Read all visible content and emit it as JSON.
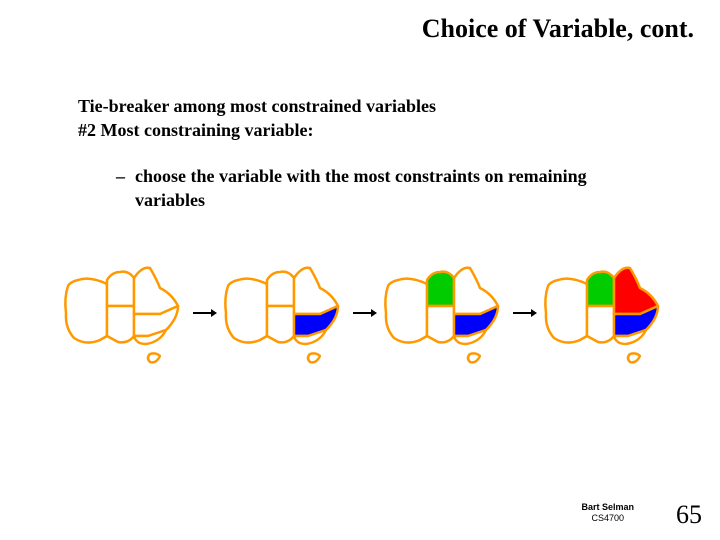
{
  "title": "Choice of Variable, cont.",
  "line1": "Tie-breaker among most constrained variables",
  "line2": "#2 Most constraining variable:",
  "bullet_dash": "–",
  "bullet_text": "choose the variable with the most constraints on remaining variables",
  "maps": [
    {
      "sa": "#ffffff",
      "nsw": "#ffffff",
      "nt": "#ffffff",
      "qld": "#ffffff"
    },
    {
      "sa": "#ffffff",
      "nsw": "#0000ff",
      "nt": "#ffffff",
      "qld": "#ffffff"
    },
    {
      "sa": "#ffffff",
      "nsw": "#0000ff",
      "nt": "#00cc00",
      "qld": "#ffffff"
    },
    {
      "sa": "#ffffff",
      "nsw": "#0000ff",
      "nt": "#00cc00",
      "qld": "#ff0000"
    }
  ],
  "colors": {
    "outline": "#ff9900",
    "arrow": "#000000"
  },
  "footer": {
    "name": "Bart Selman",
    "course": "CS4700"
  },
  "page_number": "65"
}
